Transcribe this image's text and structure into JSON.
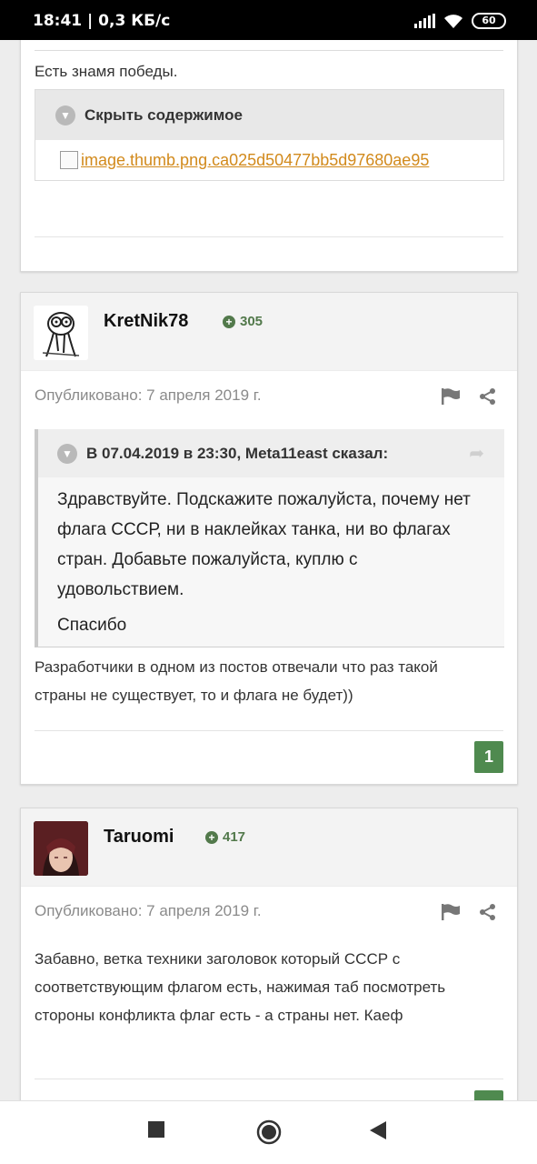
{
  "status_bar": {
    "time": "18:41 | 0,3 КБ/с",
    "battery": "60",
    "icons": [
      "signal-icon",
      "wifi-icon",
      "battery-icon"
    ]
  },
  "post_top": {
    "text": "Есть знамя победы.",
    "spoiler_label": "Скрыть содержимое",
    "image_link": "image.thumb.png.ca025d50477bb5d97680ae95"
  },
  "post_kretnik": {
    "author": "KretNik78",
    "reputation": "305",
    "published": "Опубликовано: 7 апреля 2019 г.",
    "quote": {
      "header": "В 07.04.2019 в 23:30, Meta11east сказал:",
      "paragraphs": [
        "Здравствуйте. Подскажите пожалуйста, почему нет флага СССР, ни в наклейках танка, ни во флагах стран. Добавьте пожалуйста, куплю с удовольствием.",
        "Спасибо"
      ]
    },
    "text": "Разработчики в одном из постов отвечали что раз такой страны не существует, то и флага не будет))",
    "reaction_count": "1"
  },
  "post_taruomi": {
    "author": "Taruomi",
    "reputation": "417",
    "published": "Опубликовано: 7 апреля 2019 г.",
    "text": "Забавно, ветка техники заголовок который СССР с соответствующим флагом есть, нажимая таб посмотреть стороны конфликта флаг есть - а страны нет. Каеф"
  },
  "colors": {
    "reputation": "#52794b",
    "link": "#d28a1c",
    "badge": "#4f8a4f"
  },
  "nav_bar": {
    "buttons": [
      "recent-apps-button",
      "home-button",
      "back-button"
    ]
  }
}
